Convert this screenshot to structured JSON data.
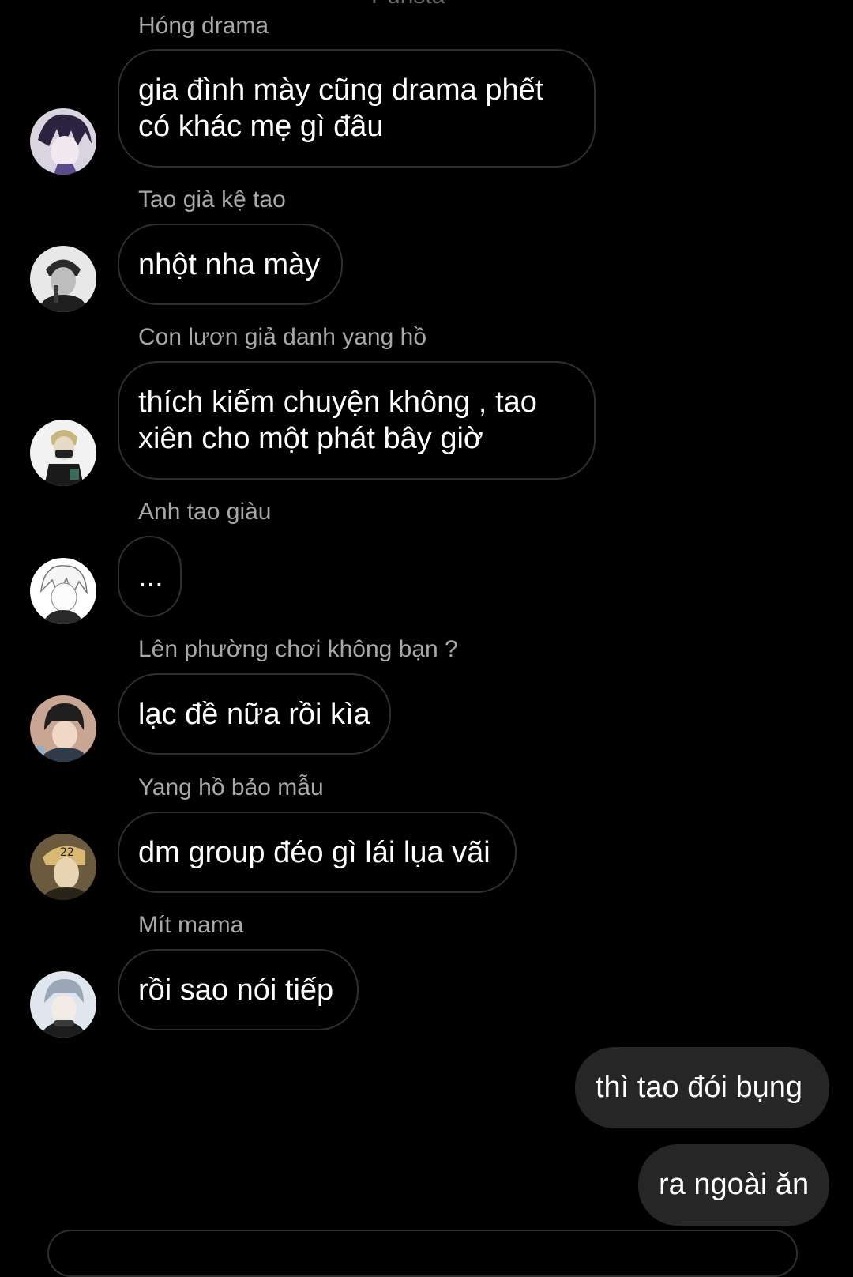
{
  "header": {
    "title_cut": "Punsta"
  },
  "messages": [
    {
      "sender": "Hóng drama",
      "text": "gia đình mày cũng drama phết\ncó khác mẹ gì đâu"
    },
    {
      "sender": "Tao già kệ tao",
      "text": "nhột nha mày"
    },
    {
      "sender": "Con lươn giả danh yang hồ",
      "text": "thích kiếm chuyện không , tao\nxiên cho một phát bây giờ"
    },
    {
      "sender": "Anh tao giàu",
      "text": "..."
    },
    {
      "sender": "Lên phường chơi không bạn ?",
      "text": "lạc đề nữa rồi kìa"
    },
    {
      "sender": "Yang hồ bảo mẫu",
      "text": "dm group đéo gì lái lụa vãi"
    },
    {
      "sender": "Mít mama",
      "text": "rồi sao nói tiếp"
    }
  ],
  "outgoing": [
    {
      "text": "thì tao đói bụng"
    },
    {
      "text": "ra ngoài ăn"
    }
  ],
  "colors": {
    "background": "#000000",
    "sender_label": "#a8a8a8",
    "incoming_border": "#2f2f2f",
    "outgoing_bg": "#262626"
  }
}
